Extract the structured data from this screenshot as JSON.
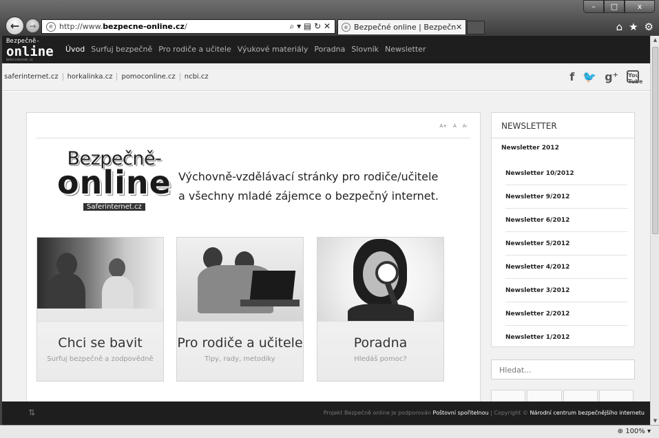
{
  "browser": {
    "url_prefix": "http://www.",
    "url_domain": "bezpecne-online.cz",
    "url_suffix": "/",
    "address_tools": "⌕ ▾ ▤ ↻ ✕",
    "tab_title": "Bezpečné online | Bezpečně...",
    "tab_close": "✕",
    "zoom": "100%",
    "zoom_icon": "magnifier-icon",
    "window_minimize": "–",
    "window_maximize": "□",
    "window_close": "x"
  },
  "site": {
    "logo_line1": "Bezpečně-",
    "logo_line2": "online",
    "logo_line3": "Saferinternet.cz",
    "nav": [
      {
        "label": "Úvod"
      },
      {
        "label": "Surfuj bezpečně"
      },
      {
        "label": "Pro rodiče a učitele"
      },
      {
        "label": "Výukové materiály"
      },
      {
        "label": "Poradna"
      },
      {
        "label": "Slovník"
      },
      {
        "label": "Newsletter"
      }
    ],
    "partners": [
      "saferinternet.cz",
      "horkalinka.cz",
      "pomoconline.cz",
      "ncbi.cz"
    ],
    "social": {
      "facebook": "f",
      "twitter": "🐦",
      "gplus": "g⁺",
      "youtube": "You Tube"
    }
  },
  "main": {
    "font_sizes": [
      "A+",
      "A",
      "A-"
    ],
    "logo": {
      "line1": "Bezpečně-",
      "line2": "online",
      "line3": "Saferinternet.cz"
    },
    "tagline_1": "Výchovně-vzdělávací stránky pro rodiče/učitele",
    "tagline_2": "a všechny mladé zájemce o bezpečný internet.",
    "tiles": [
      {
        "title": "Chci se bavit",
        "subtitle": "Surfuj bezpečně a zodpovědně"
      },
      {
        "title": "Pro rodiče a učitele",
        "subtitle": "Tipy, rady, metodiky"
      },
      {
        "title": "Poradna",
        "subtitle": "Hledáš pomoc?"
      }
    ]
  },
  "sidebar": {
    "heading": "NEWSLETTER",
    "year": "Newsletter 2012",
    "items": [
      "Newsletter 10/2012",
      "Newsletter 9/2012",
      "Newsletter 6/2012",
      "Newsletter 5/2012",
      "Newsletter 4/2012",
      "Newsletter 3/2012",
      "Newsletter 2/2012",
      "Newsletter 1/2012"
    ],
    "search_placeholder": "Hledat..."
  },
  "footer": {
    "prefix": "Projekt Bezpečně online je podporován ",
    "sponsor": "Poštovní spořitelnou",
    "middle": " | Copyright © ",
    "org": "Národní centrum bezpečnějšího internetu"
  }
}
